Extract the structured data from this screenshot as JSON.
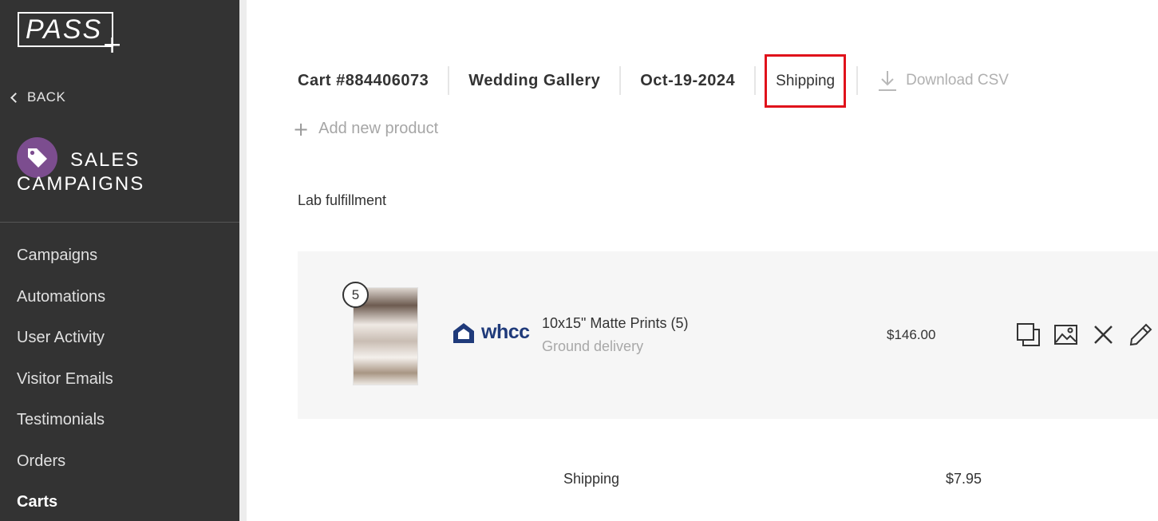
{
  "sidebar": {
    "logo_text": "PASS",
    "logo_plus": "+",
    "back_label": "BACK",
    "section_title": "SALES CAMPAIGNS",
    "section_icon": "tag-icon",
    "accent_color": "#7c4d8f",
    "items": [
      {
        "label": "Campaigns",
        "active": false
      },
      {
        "label": "Automations",
        "active": false
      },
      {
        "label": "User Activity",
        "active": false
      },
      {
        "label": "Visitor Emails",
        "active": false
      },
      {
        "label": "Testimonials",
        "active": false
      },
      {
        "label": "Orders",
        "active": false
      },
      {
        "label": "Carts",
        "active": true
      }
    ]
  },
  "header": {
    "cart_id": "Cart #884406073",
    "gallery": "Wedding Gallery",
    "date": "Oct-19-2024",
    "shipping_tab": "Shipping",
    "highlight_color": "#e0121b",
    "download_label": "Download CSV"
  },
  "add_product_label": "Add new product",
  "lab_section_title": "Lab fulfillment",
  "product": {
    "quantity": "5",
    "vendor": "whcc",
    "name": "10x15\" Matte Prints (5)",
    "delivery": "Ground delivery",
    "price": "$146.00",
    "actions": [
      "duplicate-icon",
      "image-icon",
      "close-icon",
      "pencil-icon"
    ]
  },
  "shipping_line": {
    "label": "Shipping",
    "price": "$7.95"
  }
}
